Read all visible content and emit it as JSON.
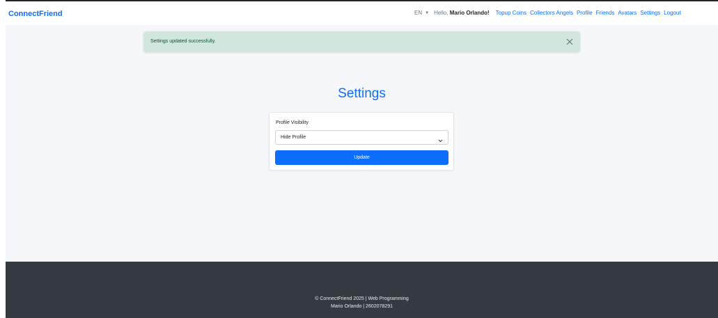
{
  "header": {
    "brand": "ConnectFriend",
    "language": "EN",
    "greeting_prefix": "Hello, ",
    "user_name": "Mario Orlando!",
    "nav": {
      "topup": "Topup Coins",
      "collectors": "Collectors Angels",
      "profile": "Profile",
      "friends": "Friends",
      "avatars": "Avatars",
      "settings": "Settings",
      "logout": "Logout"
    }
  },
  "alert": {
    "message": "Settings updated successfully.",
    "close_icon": "close-icon"
  },
  "page": {
    "title": "Settings"
  },
  "form": {
    "visibility_label": "Profile Visibility",
    "visibility_value": "Hide Profile",
    "submit_label": "Update"
  },
  "footer": {
    "line1": "© ConnectFriend 2025 | Web Programming",
    "line2": "Mario Orlando | 2602078291"
  },
  "colors": {
    "primary": "#0d6efd",
    "alert_bg": "#d1e7dd",
    "footer_bg": "#343a40",
    "page_bg": "#f5f7fa"
  }
}
